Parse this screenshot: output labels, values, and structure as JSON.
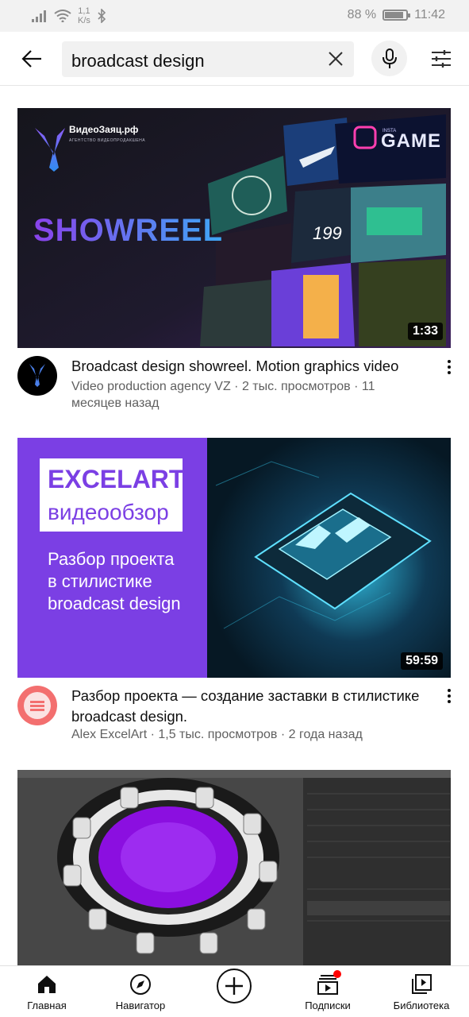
{
  "status_bar": {
    "speed_value": "1,1",
    "speed_unit": "K/s",
    "battery_percent": "88 %",
    "battery_level": 0.88,
    "time": "11:42"
  },
  "search": {
    "query": "broadcast design"
  },
  "videos": [
    {
      "title": "Broadcast design showreel. Motion graphics video",
      "meta": "Video production agency VZ · 2 тыс. просмотров · 11 месяцев назад",
      "duration": "1:33",
      "thumb_brand": "ВидеоЗаяц.рф",
      "thumb_brand_sub": "АГЕНТСТВО ВИДЕОПРОДАКШЕНА",
      "thumb_headline": "SHOWREEL",
      "thumb_tag": "GAME",
      "thumb_tag_small": "INSTA",
      "thumb_number": "199"
    },
    {
      "title": "Разбор проекта — создание заставки в стилистике broadcast design.",
      "meta": "Alex ExcelArt · 1,5 тыс. просмотров · 2 года назад",
      "duration": "59:59",
      "thumb_brand": "EXCELART",
      "thumb_sub": "видеообзор",
      "thumb_line1": "Разбор проекта",
      "thumb_line2": "в стилистике",
      "thumb_line3": "broadcast design"
    }
  ],
  "bottom_nav": [
    {
      "label": "Главная",
      "icon": "home-icon"
    },
    {
      "label": "Навигатор",
      "icon": "compass-icon"
    },
    {
      "label": "",
      "icon": "create-icon"
    },
    {
      "label": "Подписки",
      "icon": "subscriptions-icon"
    },
    {
      "label": "Библиотека",
      "icon": "library-icon"
    }
  ],
  "colors": {
    "accent_red": "#ff0000",
    "purple": "#7b3fe4",
    "meta_gray": "#606060"
  }
}
